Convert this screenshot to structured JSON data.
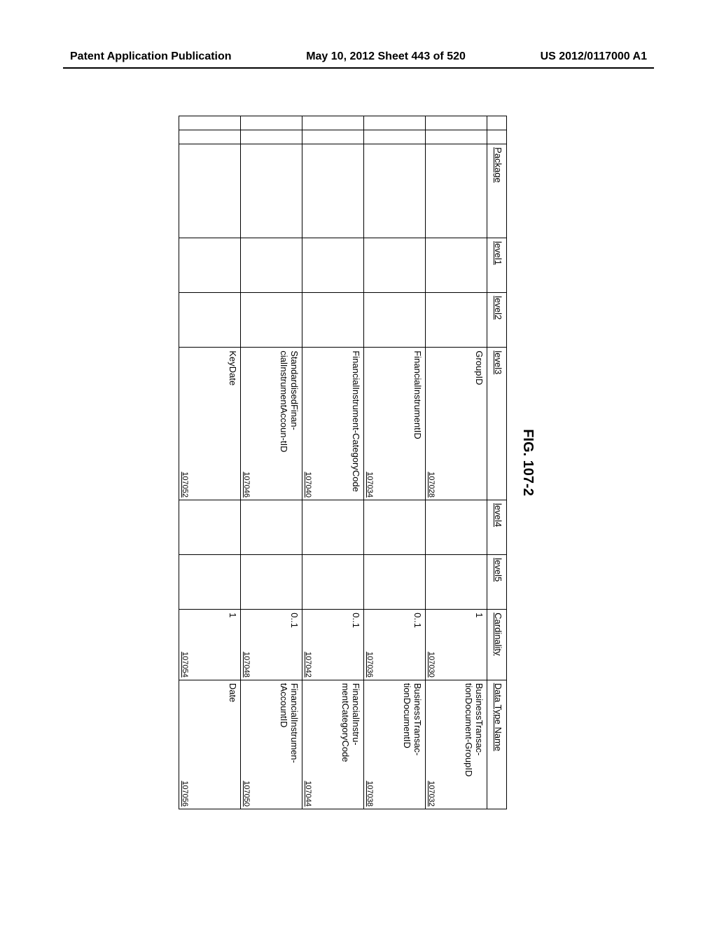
{
  "header": {
    "left": "Patent Application Publication",
    "center": "May 10, 2012  Sheet 443 of 520",
    "right": "US 2012/0117000 A1"
  },
  "figure": {
    "title": "FIG. 107-2",
    "columns": {
      "package": "Package",
      "level1": "level1",
      "level2": "level2",
      "level3": "level3",
      "level4": "level4",
      "level5": "level5",
      "cardinality": "Cardinality",
      "datatype": "Data Type Name"
    },
    "rows": [
      {
        "level3": "GroupID",
        "level3_ref": "107028",
        "cardinality": "1",
        "cardinality_ref": "107030",
        "datatype": "BusinessTransac-tionDocument-GroupID",
        "datatype_ref": "107032"
      },
      {
        "level3": "FinancialInstrumentID",
        "level3_ref": "107034",
        "cardinality": "0..1",
        "cardinality_ref": "107036",
        "datatype": "BusinessTransac-tionDocumentID",
        "datatype_ref": "107038"
      },
      {
        "level3": "FinancialInstrument-CategoryCode",
        "level3_ref": "107040",
        "cardinality": "0..1",
        "cardinality_ref": "107042",
        "datatype": "FinancialInstru-mentCategoryCode",
        "datatype_ref": "107044"
      },
      {
        "level3": "StandardisedFinan-cialInstrumentAccoun-tID",
        "level3_ref": "107046",
        "cardinality": "0..1",
        "cardinality_ref": "107048",
        "datatype": "FinancialInstrumen-tAccountID",
        "datatype_ref": "107050"
      },
      {
        "level3": "KeyDate",
        "level3_ref": "107052",
        "cardinality": "1",
        "cardinality_ref": "107054",
        "datatype": "Date",
        "datatype_ref": "107056"
      }
    ]
  }
}
